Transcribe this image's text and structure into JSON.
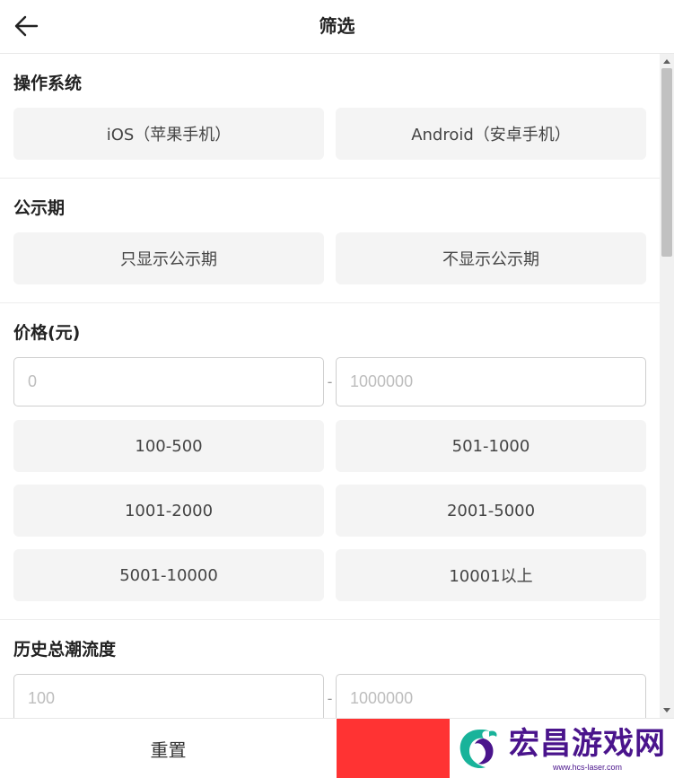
{
  "header": {
    "title": "筛选"
  },
  "sections": {
    "os": {
      "title": "操作系统",
      "options": [
        "iOS（苹果手机）",
        "Android（安卓手机）"
      ]
    },
    "notice": {
      "title": "公示期",
      "options": [
        "只显示公示期",
        "不显示公示期"
      ]
    },
    "price": {
      "title": "价格(元)",
      "min_placeholder": "0",
      "max_placeholder": "1000000",
      "separator": "-",
      "options": [
        "100-500",
        "501-1000",
        "1001-2000",
        "2001-5000",
        "5001-10000",
        "10001以上"
      ]
    },
    "heat": {
      "title": "历史总潮流度",
      "min_placeholder": "100",
      "max_placeholder": "1000000",
      "separator": "-"
    }
  },
  "footer": {
    "reset_label": "重置"
  },
  "watermark": {
    "title": "宏昌游戏网",
    "url": "www.hcs-laser.com"
  },
  "colors": {
    "confirm": "#ff3333",
    "watermark": "#4a148c"
  }
}
